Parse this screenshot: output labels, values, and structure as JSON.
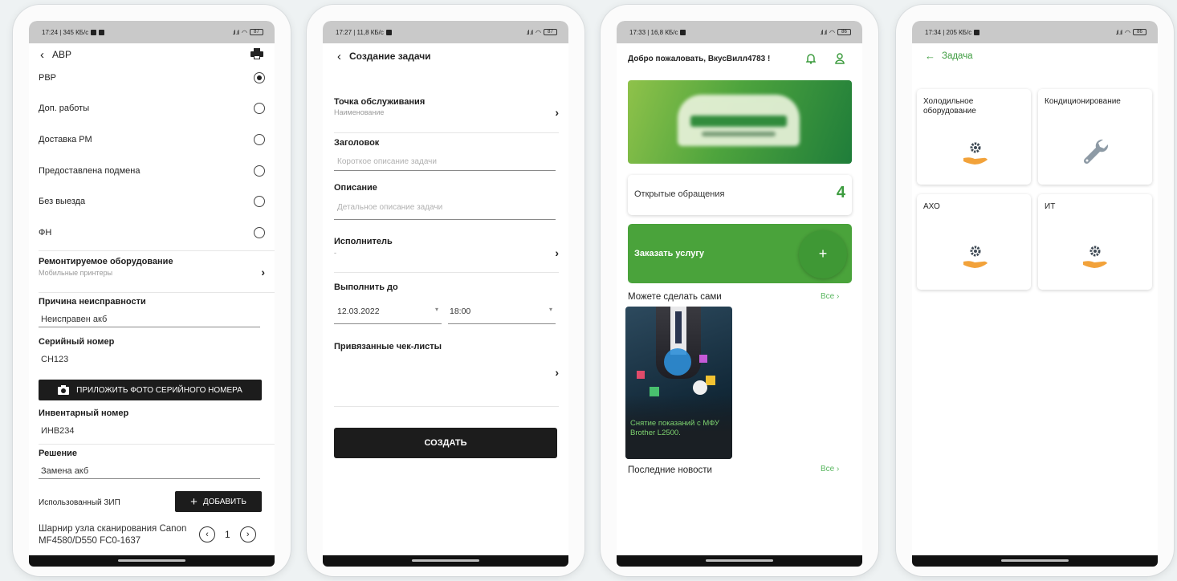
{
  "colors": {
    "brand_green": "#3d9c3f",
    "accent_orange": "#f2a23a",
    "dark_button": "#1c1c1c"
  },
  "phone1": {
    "status": {
      "time_speed": "17:24 | 345 КБ/с",
      "battery": "87"
    },
    "title": "АВР",
    "print_icon": "printer-icon",
    "options": [
      {
        "label": "РВР",
        "selected": true
      },
      {
        "label": "Доп. работы",
        "selected": false
      },
      {
        "label": "Доставка РМ",
        "selected": false
      },
      {
        "label": "Предоставлена подмена",
        "selected": false
      },
      {
        "label": "Без выезда",
        "selected": false
      },
      {
        "label": "ФН",
        "selected": false
      }
    ],
    "equipment_label": "Ремонтируемое оборудование",
    "equipment_value": "Мобильные принтеры",
    "reason_label": "Причина неисправности",
    "reason_value": "Неисправен акб",
    "serial_label": "Серийный номер",
    "serial_value": "CH123",
    "photo_button": "ПРИЛОЖИТЬ ФОТО СЕРИЙНОГО НОМЕРА",
    "inventory_label": "Инвентарный номер",
    "inventory_value": "ИНВ234",
    "solution_label": "Решение",
    "solution_value": "Замена акб",
    "zip_label": "Использованный ЗИП",
    "add_button": "ДОБАВИТЬ",
    "part_name": "Шарнир узла сканирования Canon MF4580/D550 FC0-1637",
    "part_qty": "1"
  },
  "phone2": {
    "status": {
      "time_speed": "17:27 | 11,8 КБ/с",
      "battery": "87"
    },
    "title": "Создание задачи",
    "service_point_label": "Точка обслуживания",
    "service_point_value": "Наименование",
    "header_label": "Заголовок",
    "header_placeholder": "Короткое описание задачи",
    "description_label": "Описание",
    "description_placeholder": "Детальное описание задачи",
    "executor_label": "Исполнитель",
    "executor_value": "-",
    "due_label": "Выполнить до",
    "due_date": "12.03.2022",
    "due_time": "18:00",
    "checklists_label": "Привязанные чек-листы",
    "create_button": "СОЗДАТЬ"
  },
  "phone3": {
    "status": {
      "time_speed": "17:33 | 16,8 КБ/с",
      "battery": "86"
    },
    "greeting": "Добро пожаловать, ВкусВилл4783 !",
    "open_requests_label": "Открытые обращения",
    "open_requests_count": "4",
    "order_service_label": "Заказать услугу",
    "plus": "+",
    "diy_label": "Можете сделать сами",
    "all_link": "Все",
    "article_caption": "Снятие показаний с МФУ Brother L2500.",
    "news_label": "Последние новости",
    "all_link_2": "Все"
  },
  "phone4": {
    "status": {
      "time_speed": "17:34 | 205 КБ/с",
      "battery": "86"
    },
    "title": "Задача",
    "tiles": [
      {
        "label": "Холодильное оборудование",
        "icon": "gear-hand-icon"
      },
      {
        "label": "Кондиционирование",
        "icon": "wrench-icon"
      },
      {
        "label": "АХО",
        "icon": "gear-hand-icon"
      },
      {
        "label": "ИТ",
        "icon": "gear-hand-icon"
      }
    ]
  }
}
